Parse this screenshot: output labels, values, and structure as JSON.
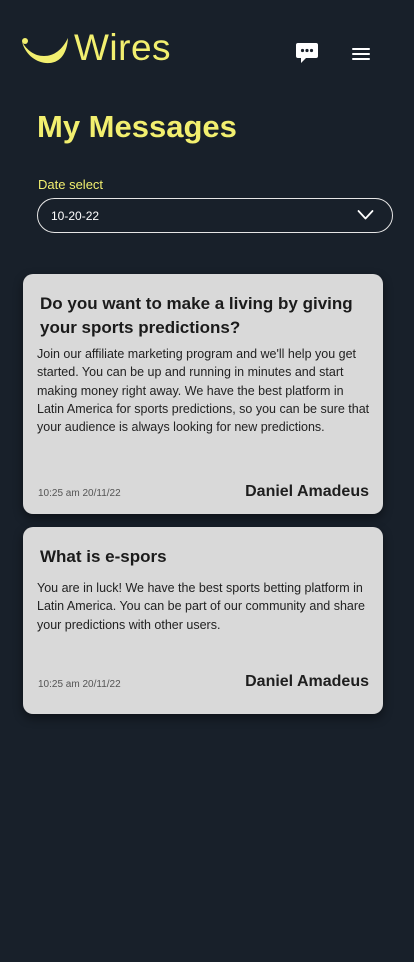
{
  "app": {
    "brand_name": "Wires",
    "brand_color": "#f2ef6f",
    "background_color": "#18202a",
    "logo_icon": "crescent-smile-logo",
    "chat_icon": "chat-bubble-icon",
    "menu_icon": "hamburger-menu-icon"
  },
  "page": {
    "title": "My Messages"
  },
  "date_filter": {
    "label": "Date select",
    "value": "10-20-22",
    "icon": "chevron-down-icon"
  },
  "messages": [
    {
      "title": "Do you want to make a living by giving your sports predictions?",
      "body": "Join our affiliate marketing program and we'll help you get started. You can be up and running in minutes and start making money right away. We have the best platform in Latin America for sports predictions, so you can be sure that your audience is always looking for new predictions.",
      "time": "10:25 am 20/11/22",
      "author": "Daniel Amadeus"
    },
    {
      "title": "What is e-spors",
      "body": "You are in luck! We have the best sports betting platform in Latin America. You can be part of our community and share your predictions with other users.",
      "time": "10:25 am 20/11/22",
      "author": "Daniel Amadeus"
    }
  ]
}
